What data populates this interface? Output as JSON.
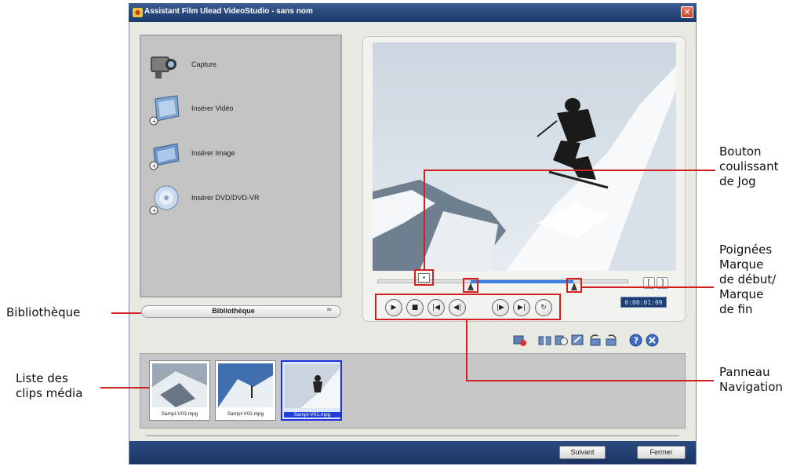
{
  "window": {
    "title": "Assistant Film Ulead VideoStudio - sans nom",
    "close_glyph": "✕"
  },
  "left_panel": {
    "items": [
      {
        "label": "Capture",
        "icon": "camcorder-icon"
      },
      {
        "label": "Insérer Vidéo",
        "icon": "insert-video-icon"
      },
      {
        "label": "Insérer Image",
        "icon": "insert-image-icon"
      },
      {
        "label": "Insérer DVD/DVD-VR",
        "icon": "dvd-icon"
      }
    ],
    "library_button": "Bibliothèque",
    "library_chevron": "≈"
  },
  "preview": {
    "timecode": "0:00:01:09",
    "bracket_in": "[",
    "bracket_out": "]",
    "jog_glyph": "▾",
    "nav_buttons": [
      {
        "name": "play-button",
        "glyph": "▶"
      },
      {
        "name": "stop-button",
        "glyph": "■"
      },
      {
        "name": "home-button",
        "glyph": "|◀"
      },
      {
        "name": "previous-frame-button",
        "glyph": "◀|"
      },
      {
        "name": "next-frame-button",
        "glyph": "|▶"
      },
      {
        "name": "end-button",
        "glyph": "▶|"
      },
      {
        "name": "repeat-button",
        "glyph": "↻"
      }
    ]
  },
  "toolbar": {
    "icons": [
      "import-icon",
      "split-icon",
      "multi-trim-icon",
      "enhance-icon",
      "rotate-left-icon",
      "rotate-right-icon",
      "help-icon",
      "delete-icon"
    ]
  },
  "media_list": {
    "clips": [
      {
        "name": "Sampl-V03.mpg",
        "selected": false
      },
      {
        "name": "Sampl-V02.mpg",
        "selected": false
      },
      {
        "name": "Sampl-V01.mpg",
        "selected": true
      }
    ]
  },
  "bottom_bar": {
    "next_label": "Suivant",
    "close_label": "Fermer"
  },
  "annotations": {
    "jog_slider": [
      "Bouton",
      "coulissant",
      "de Jog"
    ],
    "trim_handles": [
      "Poignées",
      "Marque",
      "de début/",
      "Marque",
      "de fin"
    ],
    "library": [
      "Bibliothèque"
    ],
    "media_list": [
      "Liste des",
      "clips média"
    ],
    "navigation_panel": [
      "Panneau",
      "Navigation"
    ]
  },
  "colors": {
    "title_bar": "#27467a",
    "annotation_red": "#d21f1f",
    "selection_blue": "#1f3fd8",
    "trim_blue": "#3b7ce0"
  }
}
